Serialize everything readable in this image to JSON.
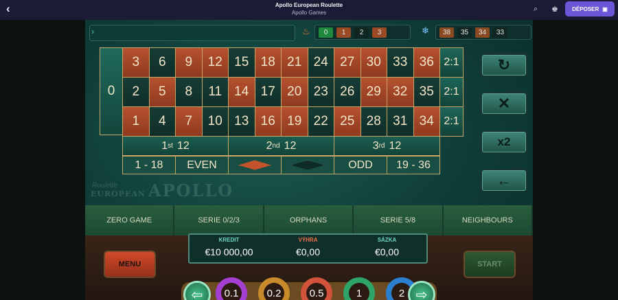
{
  "topbar": {
    "title": "Apollo European Roulette",
    "provider": "Apollo Games",
    "deposit_label": "DÉPOSER",
    "icons": [
      "back-icon",
      "search-icon",
      "trophy-icon",
      "wallet-icon"
    ]
  },
  "history": {
    "hot": [
      {
        "n": "0",
        "color": "#1f8a3e"
      },
      {
        "n": "1",
        "color": "#9a4a24"
      },
      {
        "n": "2",
        "color": "#0f2520"
      },
      {
        "n": "3",
        "color": "#9a4a24"
      }
    ],
    "cold": [
      {
        "n": "38",
        "color": "#8a4a22"
      },
      {
        "n": "35",
        "color": "#0f2520"
      },
      {
        "n": "34",
        "color": "#8a4a22"
      },
      {
        "n": "33",
        "color": "#0f2520"
      }
    ]
  },
  "board": {
    "zero": "0",
    "rows": [
      [
        "3",
        "6",
        "9",
        "12",
        "15",
        "18",
        "21",
        "24",
        "27",
        "30",
        "33",
        "36"
      ],
      [
        "2",
        "5",
        "8",
        "11",
        "14",
        "17",
        "20",
        "23",
        "26",
        "29",
        "32",
        "35"
      ],
      [
        "1",
        "4",
        "7",
        "10",
        "13",
        "16",
        "19",
        "22",
        "25",
        "28",
        "31",
        "34"
      ]
    ],
    "colors": [
      [
        "red",
        "black",
        "red",
        "red",
        "black",
        "red",
        "red",
        "black",
        "red",
        "red",
        "black",
        "red"
      ],
      [
        "black",
        "red",
        "black",
        "black",
        "red",
        "black",
        "red",
        "black",
        "black",
        "red",
        "red",
        "black"
      ],
      [
        "red",
        "black",
        "red",
        "black",
        "black",
        "red",
        "red",
        "black",
        "red",
        "black",
        "black",
        "red"
      ]
    ],
    "columns": [
      "2:1",
      "2:1",
      "2:1"
    ],
    "dozens": [
      {
        "main": "1",
        "sup": "st",
        "end": "12"
      },
      {
        "main": "2",
        "sup": "nd",
        "end": "12"
      },
      {
        "main": "3",
        "sup": "rd",
        "end": "12"
      }
    ],
    "outside": {
      "low": "1 - 18",
      "even": "EVEN",
      "odd": "ODD",
      "high": "19 - 36"
    }
  },
  "controls": {
    "undo": "↻",
    "clear": "✕",
    "double": "x2",
    "back": "←"
  },
  "logo": {
    "script": "Roulette",
    "text": "APOLLO",
    "sub": "EUROPEAN"
  },
  "bets": [
    "ZERO GAME",
    "SERIE 0/2/3",
    "ORPHANS",
    "SERIE 5/8",
    "NEIGHBOURS"
  ],
  "panel": {
    "credit_label": "KREDIT",
    "win_label": "VÝHRA",
    "bet_label": "SÁZKA",
    "credit": "€10 000,00",
    "win": "€0,00",
    "bet": "€0,00",
    "label_color": "#6fd6c0",
    "win_color": "#f0714a"
  },
  "menu_label": "MENU",
  "start_label": "START",
  "chips": [
    {
      "v": "0.1",
      "ring": "#a43fd1"
    },
    {
      "v": "0.2",
      "ring": "#c98a2b"
    },
    {
      "v": "0.5",
      "ring": "#d2533b"
    },
    {
      "v": "1",
      "ring": "#2ea468"
    },
    {
      "v": "2",
      "ring": "#2b7fd1"
    }
  ]
}
